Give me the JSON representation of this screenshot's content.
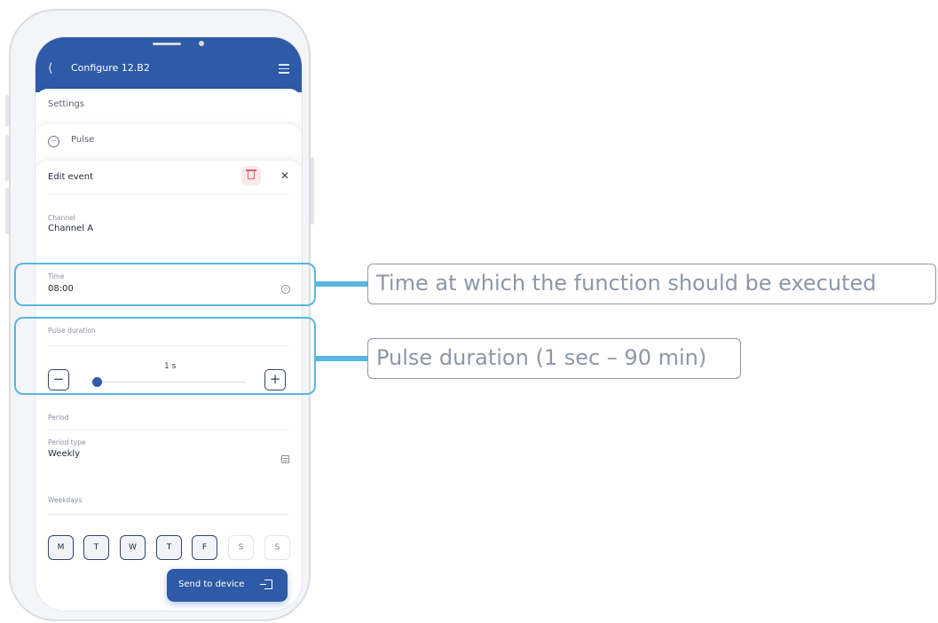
{
  "header": {
    "title": "Configure 12.B2"
  },
  "cards": {
    "settings_label": "Settings",
    "pulse_label": "Pulse"
  },
  "edit_event": {
    "title": "Edit event",
    "channel": {
      "label": "Channel",
      "value": "Channel A"
    },
    "time": {
      "label": "Time",
      "value": "08:00"
    },
    "pulse_duration": {
      "label": "Pulse duration",
      "value": "1 s",
      "minus": "−",
      "plus": "+"
    },
    "period": {
      "section_label": "Period",
      "type_label": "Period type",
      "type_value": "Weekly"
    },
    "weekdays": {
      "label": "Weekdays",
      "days": [
        {
          "label": "M",
          "selected": true
        },
        {
          "label": "T",
          "selected": true
        },
        {
          "label": "W",
          "selected": true
        },
        {
          "label": "T",
          "selected": true
        },
        {
          "label": "F",
          "selected": true
        },
        {
          "label": "S",
          "selected": false
        },
        {
          "label": "S",
          "selected": false
        }
      ]
    },
    "send_button": "Send to device"
  },
  "callouts": {
    "time": "Time at which the function should be executed",
    "pulse": "Pulse duration (1 sec – 90 min)"
  },
  "colors": {
    "primary": "#2e5aa7",
    "highlight": "#58b7e0",
    "callout_text": "#8d97a6"
  }
}
